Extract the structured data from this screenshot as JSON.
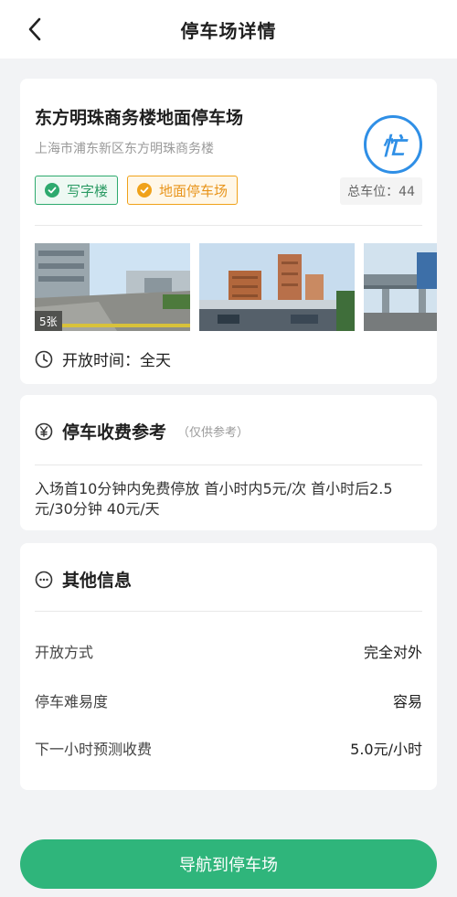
{
  "header": {
    "title": "停车场详情"
  },
  "lot": {
    "name": "东方明珠商务楼地面停车场",
    "address": "上海市浦东新区东方明珠商务楼",
    "status_label": "忙",
    "tags": [
      "写字楼",
      "地面停车场"
    ],
    "total_spots": "总车位：44",
    "photo_count": "5张",
    "hours": "开放时间：全天"
  },
  "fees": {
    "title": "停车收费参考",
    "note": "（仅供参考）",
    "text": "入场首10分钟内免费停放 首小时内5元/次 首小时后2.5元/30分钟 40元/天"
  },
  "other_info": {
    "title": "其他信息",
    "rows": [
      {
        "key": "开放方式",
        "value": "完全对外"
      },
      {
        "key": "停车难易度",
        "value": "容易"
      },
      {
        "key": "下一小时预测收费",
        "value": "5.0元/小时"
      }
    ]
  },
  "actions": {
    "navigate_label": "导航到停车场"
  },
  "colors": {
    "primary_green": "#2fb57b",
    "tag_green": "#2eaa6e",
    "tag_orange": "#f0a21a",
    "status_blue": "#2f8fe6"
  }
}
